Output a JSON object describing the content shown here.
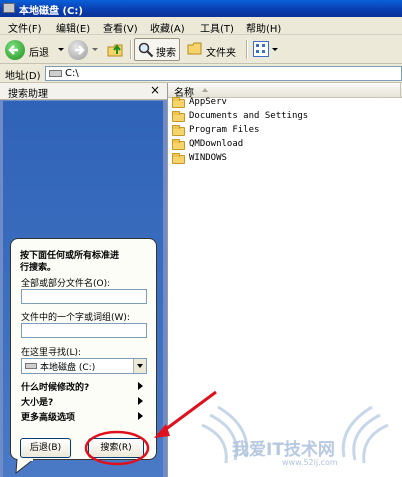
{
  "window": {
    "title": "本地磁盘 (C:)"
  },
  "menu": [
    "文件(F)",
    "编辑(E)",
    "查看(V)",
    "收藏(A)",
    "工具(T)",
    "帮助(H)"
  ],
  "toolbar": {
    "back_label": "后退",
    "search_label": "搜索",
    "folders_label": "文件夹"
  },
  "address": {
    "label": "地址(D)",
    "value": "C:\\"
  },
  "search_pane": {
    "title": "搜索助理",
    "intro": [
      "按下面任何或所有标准进",
      "行搜索。"
    ],
    "filename_label": "全部或部分文件名(O):",
    "filename_value": "",
    "phrase_label": "文件中的一个字或词组(W):",
    "phrase_value": "",
    "look_in_label": "在这里寻找(L):",
    "look_in_value": "本地磁盘 (C:)",
    "options": [
      "什么时候修改的?",
      "大小是?",
      "更多高级选项"
    ],
    "back_button": "后退(B)",
    "search_button": "搜索(R)"
  },
  "file_list": {
    "column_name": "名称",
    "items": [
      "AppServ",
      "Documents and Settings",
      "Program Files",
      "QMDownload",
      "WINDOWS"
    ]
  },
  "watermark": {
    "text": "我爱IT技术网",
    "url": "www.52ij.com"
  },
  "colors": {
    "titlebar": "#0a3fb3",
    "pane": "#2f63b8",
    "highlight": "#e0101c"
  }
}
